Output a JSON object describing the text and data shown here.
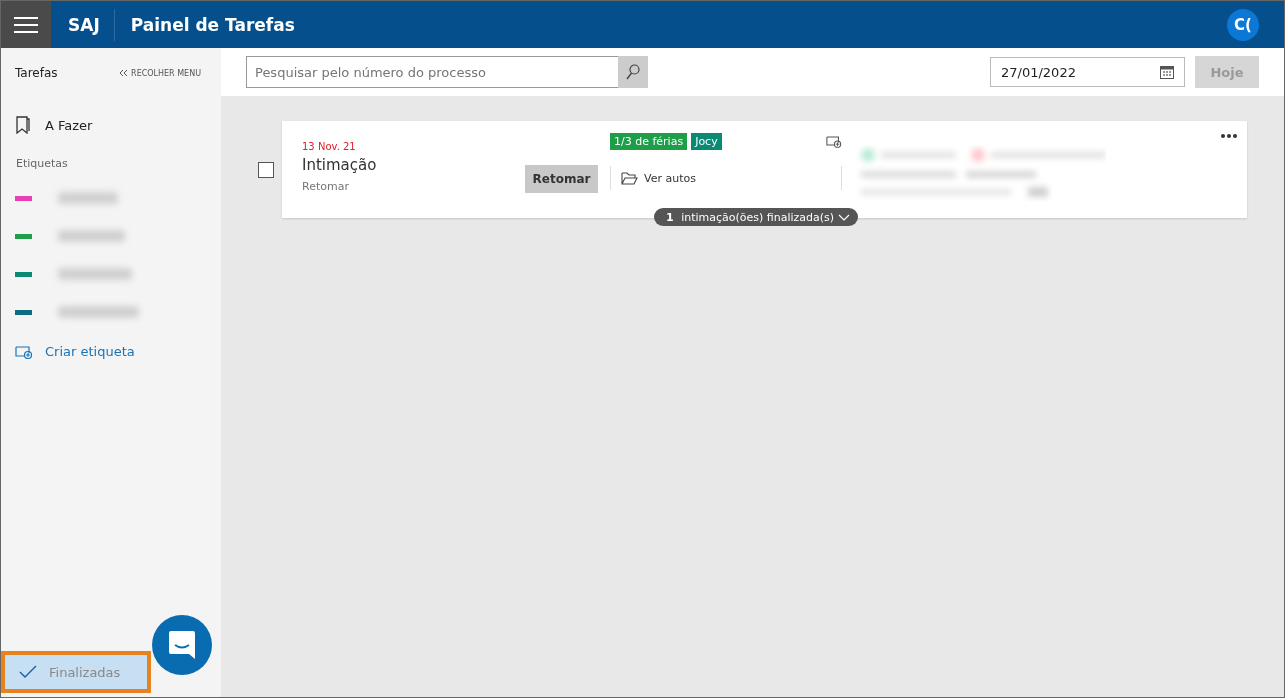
{
  "header": {
    "app": "SAJ",
    "title": "Painel de Tarefas",
    "avatar": "C("
  },
  "sidebar": {
    "title": "Tarefas",
    "collapse": "RECOLHER MENU",
    "todo": "A Fazer",
    "labels_title": "Etiquetas",
    "labels": [
      {
        "color": "#e83fb6"
      },
      {
        "color": "#1e9e48"
      },
      {
        "color": "#0b8a73"
      },
      {
        "color": "#0a6e80"
      }
    ],
    "create_label": "Criar etiqueta",
    "finished": {
      "label": "Finalizadas",
      "selected": true,
      "highlighted": true
    }
  },
  "toolbar": {
    "search": {
      "placeholder": "Pesquisar pelo número do processo"
    },
    "date": "27/01/2022",
    "today": "Hoje"
  },
  "task": {
    "checked": false,
    "date": "13 Nov. 21",
    "title": "Intimação",
    "status": "Retomar",
    "action": "Retomar",
    "tags": [
      {
        "label": "1/3 de férias",
        "color": "#1e9e48"
      },
      {
        "label": "Jocy",
        "color": "#0b8a73"
      }
    ],
    "link": "Ver autos",
    "count": "1",
    "summary": "intimação(ões) finalizada(s)"
  }
}
